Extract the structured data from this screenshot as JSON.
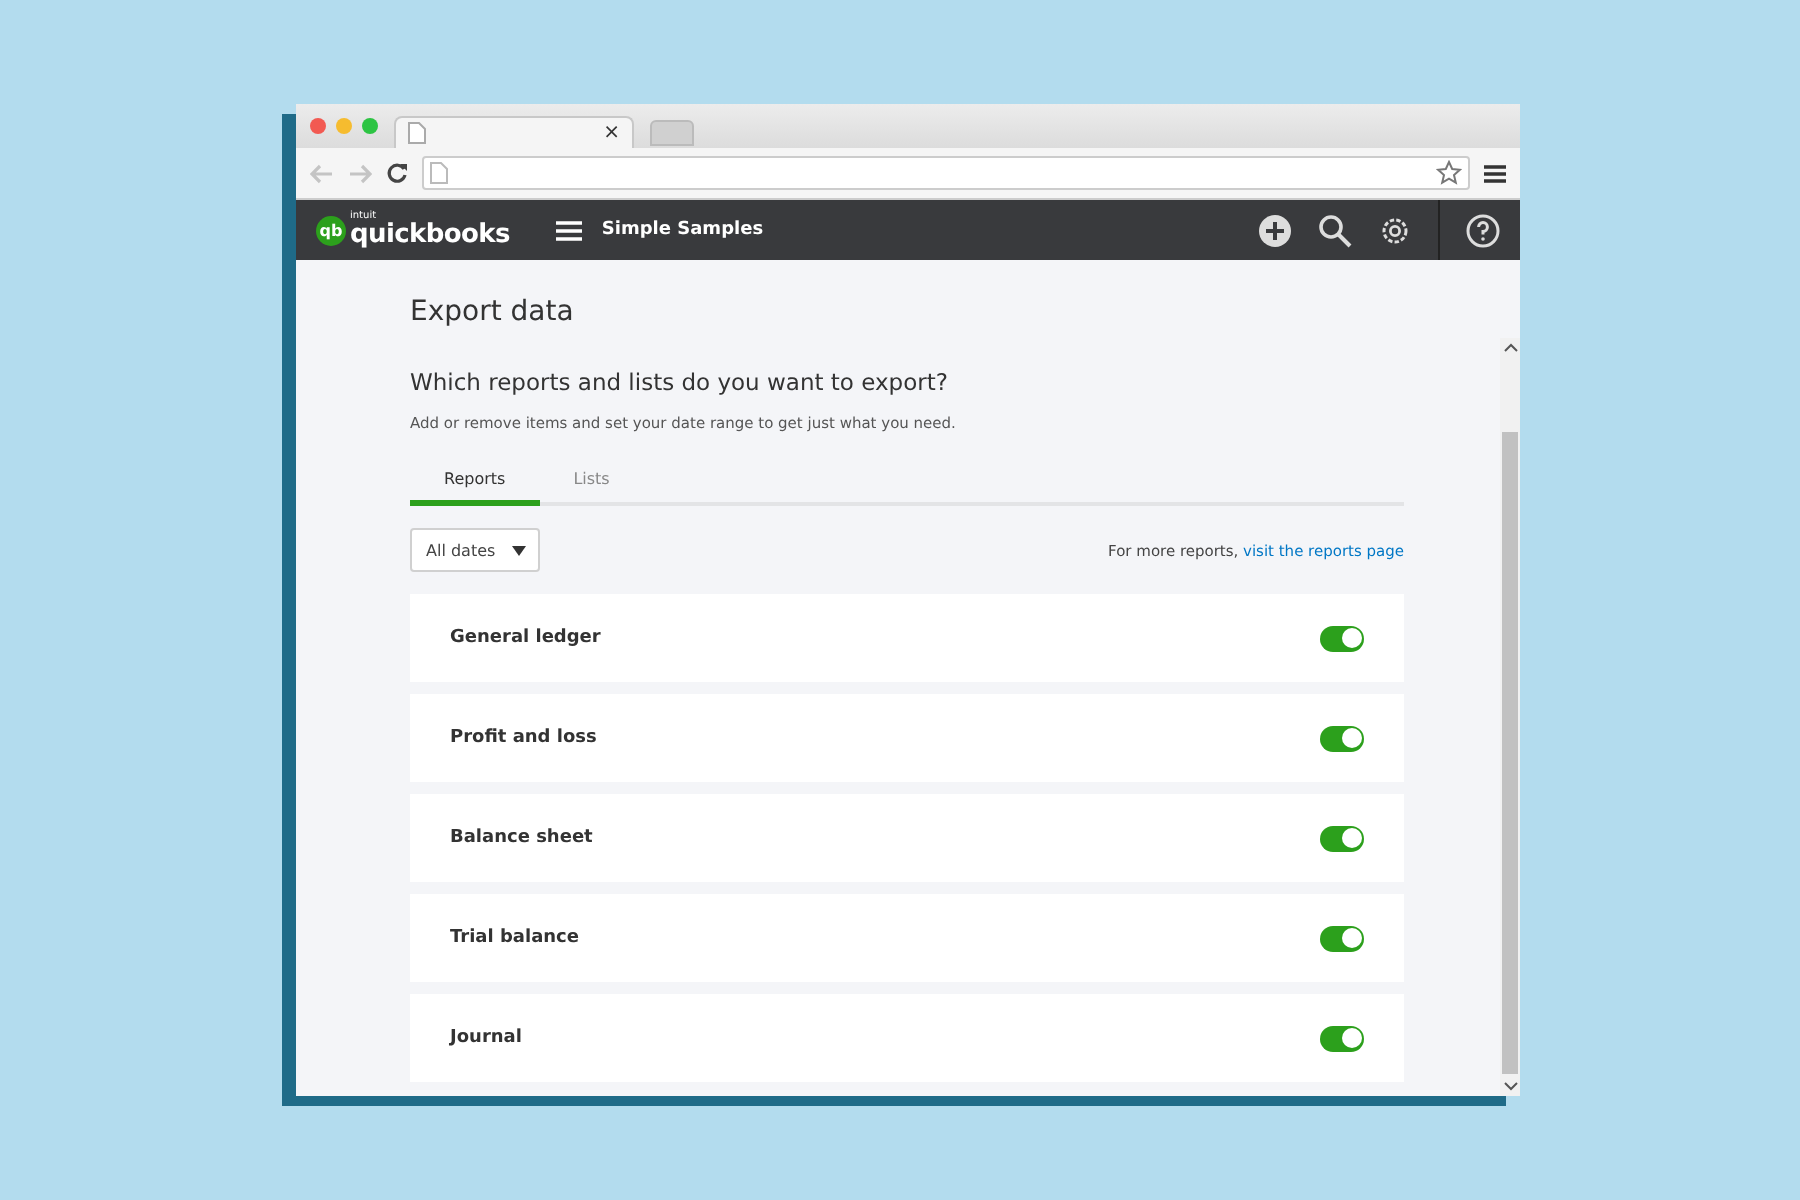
{
  "browser": {
    "tab_close": "×"
  },
  "header": {
    "logo_mark": "qb",
    "logo_small": "intuit",
    "logo_text": "quickbooks",
    "company": "Simple Samples"
  },
  "page": {
    "title": "Export data",
    "question": "Which reports and lists do you want to export?",
    "hint": "Add or remove items and set your date range to get just what you need."
  },
  "tabs": [
    {
      "label": "Reports",
      "selected": true
    },
    {
      "label": "Lists",
      "selected": false
    }
  ],
  "date_filter": {
    "value": "All dates"
  },
  "more": {
    "text": "For more reports, ",
    "link": "visit the reports page"
  },
  "reports": [
    {
      "name": "General ledger",
      "on": true
    },
    {
      "name": "Profit and loss",
      "on": true
    },
    {
      "name": "Balance sheet",
      "on": true
    },
    {
      "name": "Trial balance",
      "on": true
    },
    {
      "name": "Journal",
      "on": true
    }
  ]
}
